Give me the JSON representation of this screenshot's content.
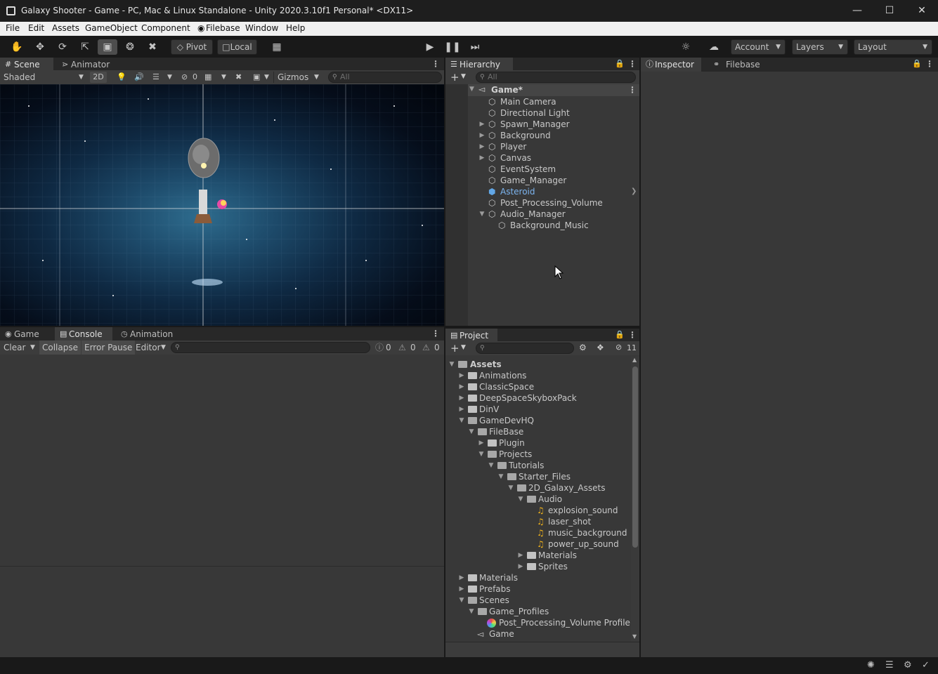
{
  "window": {
    "title": "Galaxy Shooter - Game - PC, Mac & Linux Standalone - Unity 2020.3.10f1 Personal* <DX11>"
  },
  "menu": [
    "File",
    "Edit",
    "Assets",
    "GameObject",
    "Component",
    "Filebase",
    "Window",
    "Help"
  ],
  "toolbar": {
    "pivot": "Pivot",
    "local": "Local",
    "account": "Account",
    "layers": "Layers",
    "layout": "Layout"
  },
  "scene": {
    "tabs": [
      "Scene",
      "Animator"
    ],
    "shading": "Shaded",
    "mode_2d": "2D",
    "hidden_count": "0",
    "gizmos": "Gizmos",
    "search_placeholder": "All"
  },
  "hierarchy": {
    "tab": "Hierarchy",
    "search_placeholder": "All",
    "root": "Game*",
    "items": [
      {
        "label": "Main Camera"
      },
      {
        "label": "Directional Light"
      },
      {
        "label": "Spawn_Manager"
      },
      {
        "label": "Background"
      },
      {
        "label": "Player"
      },
      {
        "label": "Canvas"
      },
      {
        "label": "EventSystem"
      },
      {
        "label": "Game_Manager"
      },
      {
        "label": "Asteroid"
      },
      {
        "label": "Post_Processing_Volume"
      },
      {
        "label": "Audio_Manager"
      },
      {
        "label": "Background_Music"
      }
    ]
  },
  "inspector": {
    "tabs": [
      "Inspector",
      "Filebase"
    ]
  },
  "console": {
    "tabs": [
      "Game",
      "Console",
      "Animation"
    ],
    "clear": "Clear",
    "collapse": "Collapse",
    "error_pause": "Error Pause",
    "editor": "Editor",
    "log_count": "0",
    "warn_count": "0",
    "error_count": "0"
  },
  "project": {
    "tab": "Project",
    "hidden_count": "11",
    "items": [
      {
        "label": "Assets"
      },
      {
        "label": "Animations"
      },
      {
        "label": "ClassicSpace"
      },
      {
        "label": "DeepSpaceSkyboxPack"
      },
      {
        "label": "DinV"
      },
      {
        "label": "GameDevHQ"
      },
      {
        "label": "FileBase"
      },
      {
        "label": "Plugin"
      },
      {
        "label": "Projects"
      },
      {
        "label": "Tutorials"
      },
      {
        "label": "Starter_Files"
      },
      {
        "label": "2D_Galaxy_Assets"
      },
      {
        "label": "Audio"
      },
      {
        "label": "explosion_sound"
      },
      {
        "label": "laser_shot"
      },
      {
        "label": "music_background"
      },
      {
        "label": "power_up_sound"
      },
      {
        "label": "Materials"
      },
      {
        "label": "Sprites"
      },
      {
        "label": "Materials"
      },
      {
        "label": "Prefabs"
      },
      {
        "label": "Scenes"
      },
      {
        "label": "Game_Profiles"
      },
      {
        "label": "Post_Processing_Volume Profile"
      },
      {
        "label": "Game"
      }
    ]
  }
}
